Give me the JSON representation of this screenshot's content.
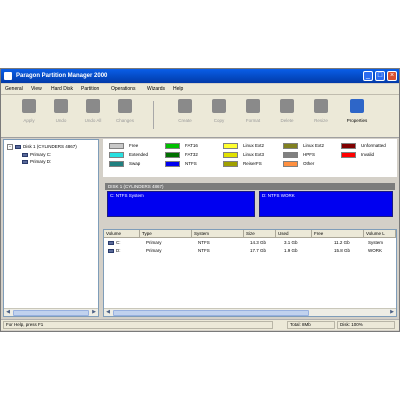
{
  "window": {
    "title": "Paragon Partition Manager 2000",
    "min_label": "_",
    "max_label": "□",
    "close_label": "×"
  },
  "menu": [
    "General",
    "View",
    "Hard Disk",
    "Partition",
    "Operations",
    "Wizards",
    "Help"
  ],
  "toolbar": {
    "group1": [
      {
        "label": "Apply",
        "icon": "apply-icon",
        "color": "#8a8a8a"
      },
      {
        "label": "Undo",
        "icon": "undo-icon",
        "color": "#8a8a8a"
      },
      {
        "label": "Undo All",
        "icon": "undo-all-icon",
        "color": "#8a8a8a"
      },
      {
        "label": "Changes",
        "icon": "changes-icon",
        "color": "#8a8a8a"
      }
    ],
    "group2": [
      {
        "label": "Create",
        "icon": "create-partition-icon",
        "color": "#8a8a8a"
      },
      {
        "label": "Copy",
        "icon": "copy-partition-icon",
        "color": "#8a8a8a"
      },
      {
        "label": "Format",
        "icon": "format-icon",
        "color": "#8a8a8a"
      },
      {
        "label": "Delete",
        "icon": "delete-icon",
        "color": "#8a8a8a"
      },
      {
        "label": "Resize",
        "icon": "resize-icon",
        "color": "#8a8a8a"
      },
      {
        "label": "Properties",
        "icon": "properties-icon",
        "color": "#2e66c8"
      }
    ]
  },
  "tree": {
    "disk": "Disk 1 (CYLINDERS 4867)",
    "items": [
      "Primary C:",
      "Primary D:"
    ]
  },
  "legend": [
    {
      "label": "Free",
      "color": "#c8c8c8"
    },
    {
      "label": "Extended",
      "color": "#28e0e0"
    },
    {
      "label": "Swap",
      "color": "#208080"
    },
    {
      "label": "FAT16",
      "color": "#00c000"
    },
    {
      "label": "FAT32",
      "color": "#007000"
    },
    {
      "label": "NTFS",
      "color": "#0000f0"
    },
    {
      "label": "Linux Ext2",
      "color": "#ffff30"
    },
    {
      "label": "Linux Ext3",
      "color": "#e0e000"
    },
    {
      "label": "ReiserFS",
      "color": "#a0a000"
    },
    {
      "label": "Linux Ext2",
      "color": "#808020"
    },
    {
      "label": "HPFS",
      "color": "#808080"
    },
    {
      "label": "Other",
      "color": "#ff9040"
    },
    {
      "label": "Unformatted",
      "color": "#800000"
    },
    {
      "label": "Invalid",
      "color": "#ff0000"
    }
  ],
  "diskmap": {
    "header": "DISK 1 (CYLINDERS 4867)",
    "partitions": [
      {
        "label": "C: NTFS System"
      },
      {
        "label": "D: NTFS WORK"
      }
    ]
  },
  "list": {
    "headers": [
      "Volume",
      "Type",
      "System",
      "Size",
      "Used",
      "Free",
      "Volume L"
    ],
    "rows": [
      [
        "C:",
        "Primary",
        "NTFS",
        "14.3 Gb",
        "3.1 Gb",
        "11.2 Gb",
        "System"
      ],
      [
        "D:",
        "Primary",
        "NTFS",
        "17.7 Gb",
        "1.9 Gb",
        "15.8 Gb",
        "WORK"
      ]
    ]
  },
  "status": {
    "help": "For Help, press F1",
    "total": "Total: 8Mb",
    "disk": "Disk: 100%"
  }
}
